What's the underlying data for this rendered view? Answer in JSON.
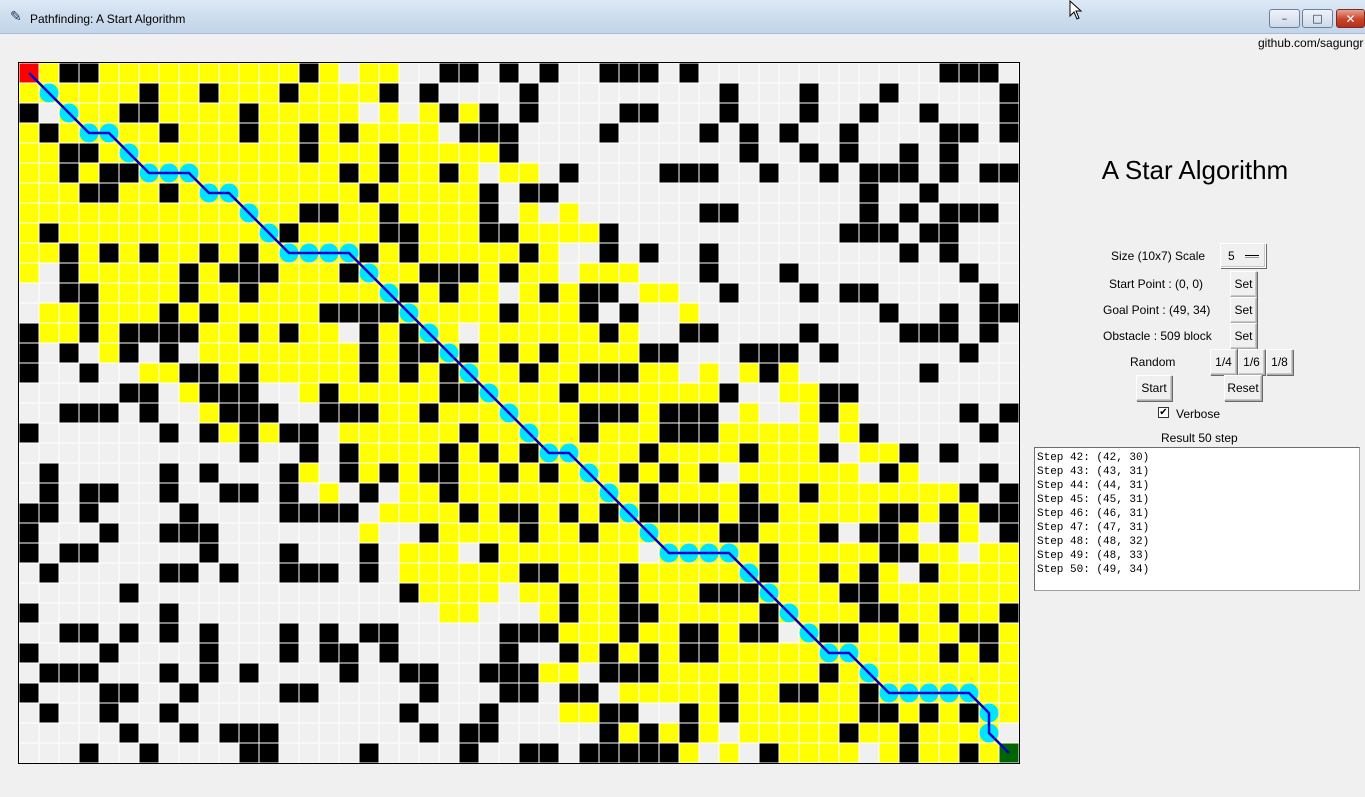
{
  "window": {
    "title": "Pathfinding: A Start Algorithm",
    "icon": "feather-icon",
    "buttons": {
      "minimize": "–",
      "maximize": "□",
      "close": "✕"
    }
  },
  "header": {
    "github_text": "github.com/sagungr"
  },
  "panel": {
    "title": "A Star Algorithm",
    "size_label": "Size (10x7) Scale",
    "size_value": "5",
    "start_label": "Start Point : (0, 0)",
    "goal_label": "Goal Point : (49, 34)",
    "obstacle_label": "Obstacle : 509 block",
    "set_label": "Set",
    "random_label": "Random",
    "random_options": [
      "1/4",
      "1/6",
      "1/8"
    ],
    "start_button": "Start",
    "reset_button": "Reset",
    "verbose_label": "Verbose",
    "verbose_checked": true,
    "result": "Result 50 step",
    "log": [
      "Step 42: (42, 30)",
      "Step 43: (43, 31)",
      "Step 44: (44, 31)",
      "Step 45: (45, 31)",
      "Step 46: (46, 31)",
      "Step 47: (47, 31)",
      "Step 48: (48, 32)",
      "Step 49: (48, 33)",
      "Step 50: (49, 34)"
    ]
  },
  "grid": {
    "cols": 50,
    "rows": 35,
    "start": [
      0,
      0
    ],
    "goal": [
      49,
      34
    ],
    "colors": {
      "empty": "#f0f0f0",
      "obstacle": "#000000",
      "explored": "#ffff00",
      "start": "#ff0000",
      "goal": "#006400",
      "path_node": "#00e5ff",
      "path_line": "#0000cc",
      "gridline": "#ffffff"
    },
    "path": [
      [
        0,
        0
      ],
      [
        1,
        1
      ],
      [
        2,
        2
      ],
      [
        3,
        3
      ],
      [
        4,
        3
      ],
      [
        5,
        4
      ],
      [
        6,
        5
      ],
      [
        7,
        5
      ],
      [
        8,
        5
      ],
      [
        9,
        6
      ],
      [
        10,
        6
      ],
      [
        11,
        7
      ],
      [
        12,
        8
      ],
      [
        13,
        9
      ],
      [
        14,
        9
      ],
      [
        15,
        9
      ],
      [
        16,
        9
      ],
      [
        17,
        10
      ],
      [
        18,
        11
      ],
      [
        19,
        12
      ],
      [
        20,
        13
      ],
      [
        21,
        14
      ],
      [
        22,
        15
      ],
      [
        23,
        16
      ],
      [
        24,
        17
      ],
      [
        25,
        18
      ],
      [
        26,
        19
      ],
      [
        27,
        19
      ],
      [
        28,
        20
      ],
      [
        29,
        21
      ],
      [
        30,
        22
      ],
      [
        31,
        23
      ],
      [
        32,
        24
      ],
      [
        33,
        24
      ],
      [
        34,
        24
      ],
      [
        35,
        24
      ],
      [
        36,
        25
      ],
      [
        37,
        26
      ],
      [
        38,
        27
      ],
      [
        39,
        28
      ],
      [
        40,
        29
      ],
      [
        41,
        29
      ],
      [
        42,
        30
      ],
      [
        43,
        31
      ],
      [
        44,
        31
      ],
      [
        45,
        31
      ],
      [
        46,
        31
      ],
      [
        47,
        31
      ],
      [
        48,
        32
      ],
      [
        48,
        33
      ],
      [
        49,
        34
      ]
    ]
  }
}
